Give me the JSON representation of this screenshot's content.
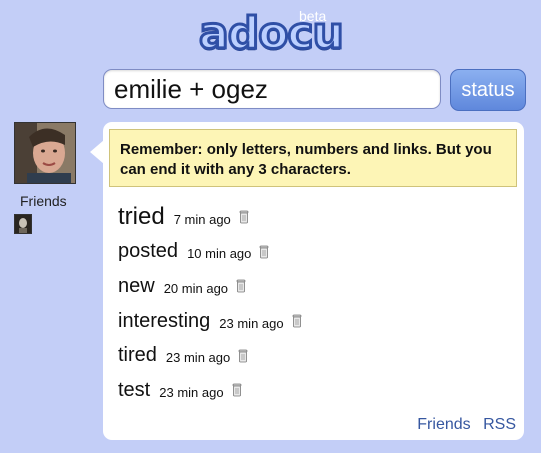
{
  "logo": {
    "text": "adocu",
    "badge": "beta"
  },
  "status_bar": {
    "input_value": "emilie + ogez",
    "button_label": "status"
  },
  "sidebar": {
    "friends_label": "Friends"
  },
  "notice": {
    "text": "Remember: only letters, numbers and links. But you can end it with any 3 characters."
  },
  "entries": [
    {
      "word": "tried",
      "time": "7 min ago"
    },
    {
      "word": "posted",
      "time": "10 min ago"
    },
    {
      "word": "new",
      "time": "20 min ago"
    },
    {
      "word": "interesting",
      "time": "23 min ago"
    },
    {
      "word": "tired",
      "time": "23 min ago"
    },
    {
      "word": "test",
      "time": "23 min ago"
    }
  ],
  "footer": {
    "friends_link": "Friends",
    "rss_link": "RSS"
  },
  "colors": {
    "background": "#c3cef7",
    "notice_background": "#fdf5b6",
    "link": "#3657a0",
    "button": "#6f97e4"
  }
}
